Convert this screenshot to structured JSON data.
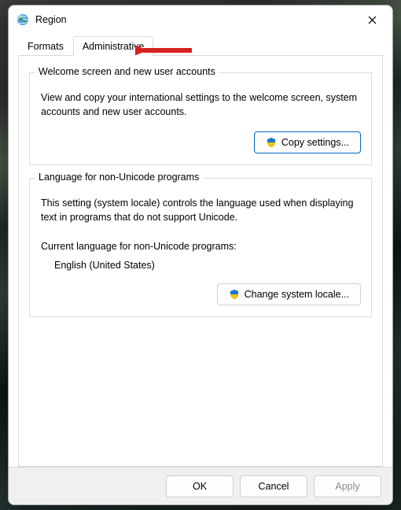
{
  "window": {
    "title": "Region"
  },
  "tabs": {
    "formats": "Formats",
    "administrative": "Administrative"
  },
  "group1": {
    "legend": "Welcome screen and new user accounts",
    "text": "View and copy your international settings to the welcome screen, system accounts and new user accounts.",
    "button": "Copy settings..."
  },
  "group2": {
    "legend": "Language for non-Unicode programs",
    "text": "This setting (system locale) controls the language used when displaying text in programs that do not support Unicode.",
    "current_label": "Current language for non-Unicode programs:",
    "current_value": "English (United States)",
    "button": "Change system locale..."
  },
  "footer": {
    "ok": "OK",
    "cancel": "Cancel",
    "apply": "Apply"
  },
  "colors": {
    "accent": "#0067c0"
  }
}
